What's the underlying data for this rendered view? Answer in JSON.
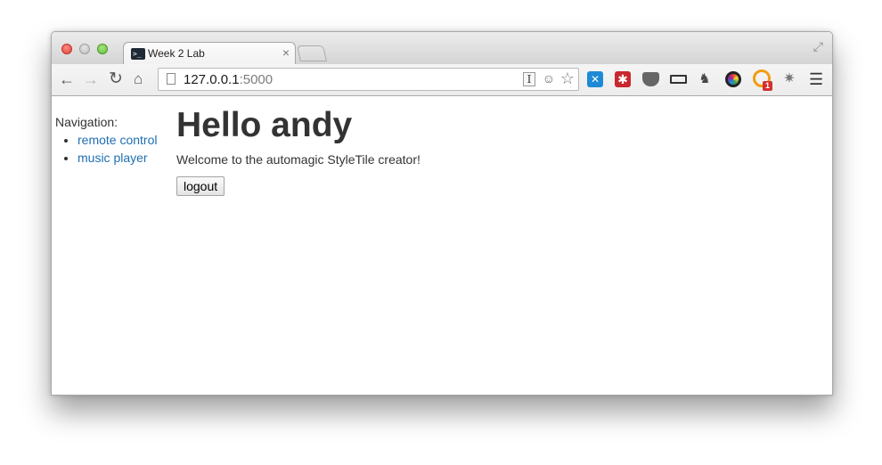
{
  "window": {
    "tabs": [
      {
        "title": "Week 2 Lab",
        "favicon": "terminal-icon",
        "close_glyph": "×"
      }
    ]
  },
  "toolbar": {
    "url_host": "127.0.0.1",
    "url_port": ":5000",
    "icons": [
      "back-arrow-icon",
      "forward-arrow-icon",
      "reload-icon",
      "home-icon",
      "page-icon",
      "reader-icon",
      "alien-icon",
      "star-icon",
      "extension-icon",
      "pocket-icon",
      "ruler-icon",
      "evernote-icon",
      "color-wheel-icon",
      "bug-icon",
      "menu-icon"
    ],
    "ext_badge": "1"
  },
  "page": {
    "sidebar": {
      "heading": "Navigation:",
      "links": [
        {
          "label": "remote control"
        },
        {
          "label": "music player"
        }
      ]
    },
    "main": {
      "greeting": "Hello andy",
      "welcome": "Welcome to the automagic StyleTile creator!",
      "logout_label": "logout"
    }
  },
  "colors": {
    "link": "#1f6fb2",
    "text": "#333333"
  }
}
